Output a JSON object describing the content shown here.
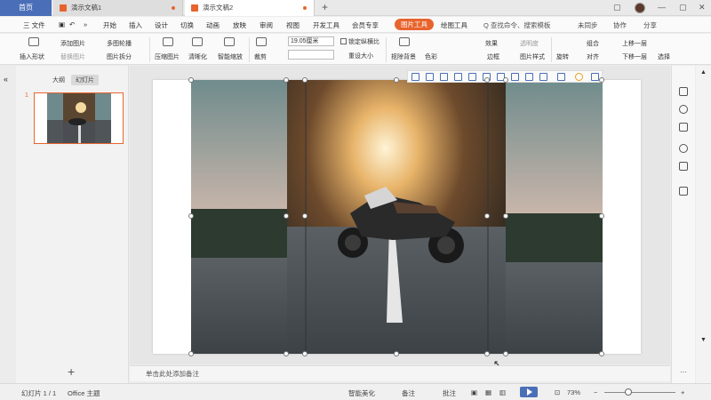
{
  "tabs": {
    "home": "首页",
    "doc1": "演示文稿1",
    "doc2": "演示文稿2",
    "new_tab": "+"
  },
  "menu": {
    "file": "三 文件",
    "items": [
      "开始",
      "插入",
      "设计",
      "切换",
      "动画",
      "放映",
      "审阅",
      "视图",
      "开发工具",
      "会员专享"
    ],
    "picture_tools": "图片工具",
    "text_tools": "绘图工具",
    "search": "Q 查找命令、搜索模板",
    "unsynced": "未同步",
    "collab": "协作",
    "share": "分享"
  },
  "ribbon": {
    "insert_shape": "插入形状",
    "add_picture": "添加图片",
    "replace_picture": "替换图片",
    "multi_outline": "多图轮播",
    "picture_split": "图片拆分",
    "compress": "压缩图片",
    "clarity": "清晰化",
    "smart_scale": "智能缩放",
    "crop": "裁剪",
    "width_value": "19.05厘米",
    "lock_ratio": "锁定纵横比",
    "reset_size": "重设大小",
    "remove_bg": "抠除背景",
    "color": "色彩",
    "effects": "效果",
    "picture_outline": "边框",
    "picture_style": "图片样式",
    "rotate": "旋转",
    "align": "对齐",
    "combine": "组合",
    "move_up": "上移一层",
    "move_down": "下移一层",
    "select": "选择",
    "transparency": "透明度"
  },
  "left_panel": {
    "tab_outline": "大纲",
    "tab_slides": "幻灯片",
    "slide_number": "1",
    "add_slide": "+"
  },
  "notes_placeholder": "单击此处添加备注",
  "status": {
    "slide_count": "幻灯片 1 / 1",
    "theme": "Office 主题",
    "smart_beautify": "智能美化",
    "notes": "备注",
    "comments": "批注",
    "zoom": "73%",
    "zoom_minus": "−",
    "zoom_plus": "+"
  },
  "colors": {
    "accent": "#e8642e",
    "home_tab": "#4a6fb8"
  }
}
